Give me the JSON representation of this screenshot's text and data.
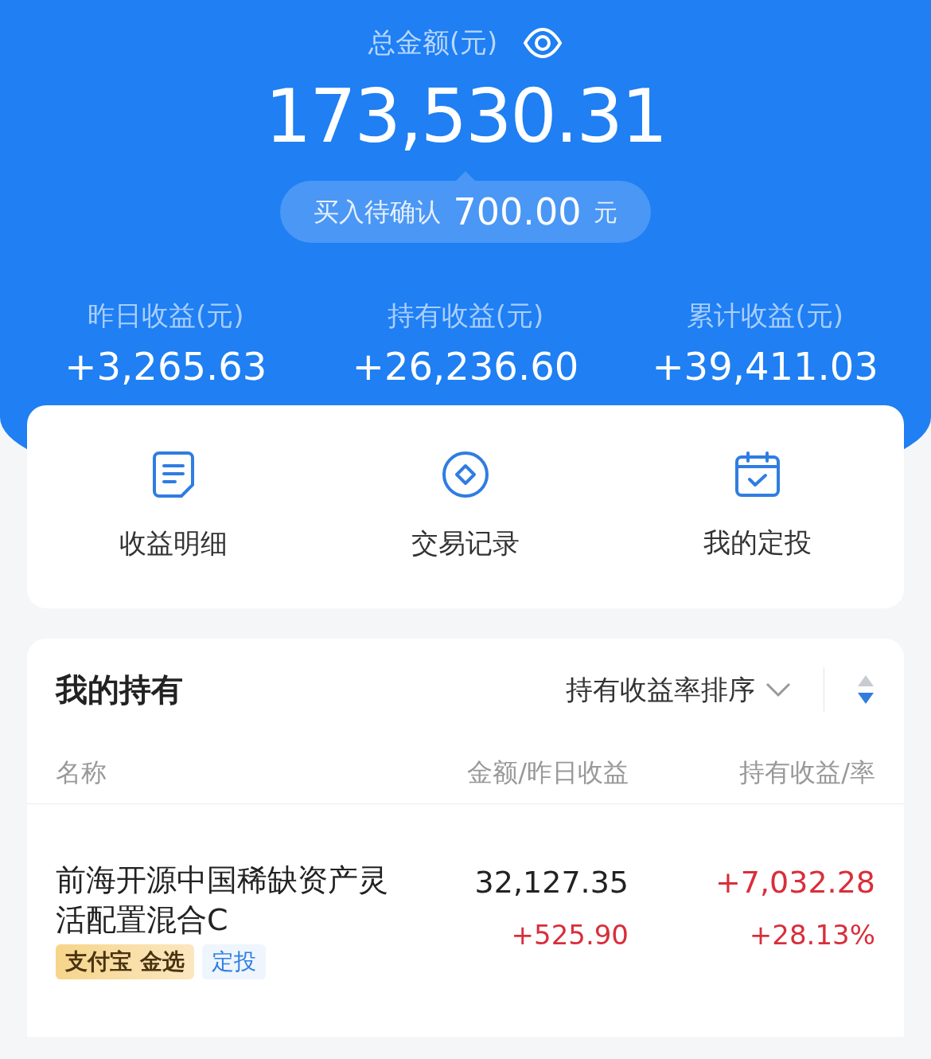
{
  "header": {
    "title": "总金额(元)",
    "total": "173,530.31",
    "pending": {
      "label": "买入待确认",
      "amount": "700.00",
      "unit": "元"
    }
  },
  "stats": [
    {
      "label": "昨日收益(元)",
      "value": "+3,265.63"
    },
    {
      "label": "持有收益(元)",
      "value": "+26,236.60"
    },
    {
      "label": "累计收益(元)",
      "value": "+39,411.03"
    }
  ],
  "shortcuts": [
    {
      "kind": "document",
      "label": "收益明细"
    },
    {
      "kind": "diamond",
      "label": "交易记录"
    },
    {
      "kind": "calendar",
      "label": "我的定投"
    }
  ],
  "holdings": {
    "title": "我的持有",
    "sort_label": "持有收益率排序",
    "sort_descending": true,
    "columns": [
      "名称",
      "金额/昨日收益",
      "持有收益/率"
    ],
    "rows": [
      {
        "name": "前海开源中国稀缺资产灵活配置混合C",
        "tags": [
          {
            "kind": "gold",
            "label": "支付宝 金选"
          },
          {
            "kind": "plain",
            "label": "定投"
          }
        ],
        "amount": "32,127.35",
        "daily": "+525.90",
        "profit": "+7,032.28",
        "rate": "+28.13%"
      }
    ]
  }
}
